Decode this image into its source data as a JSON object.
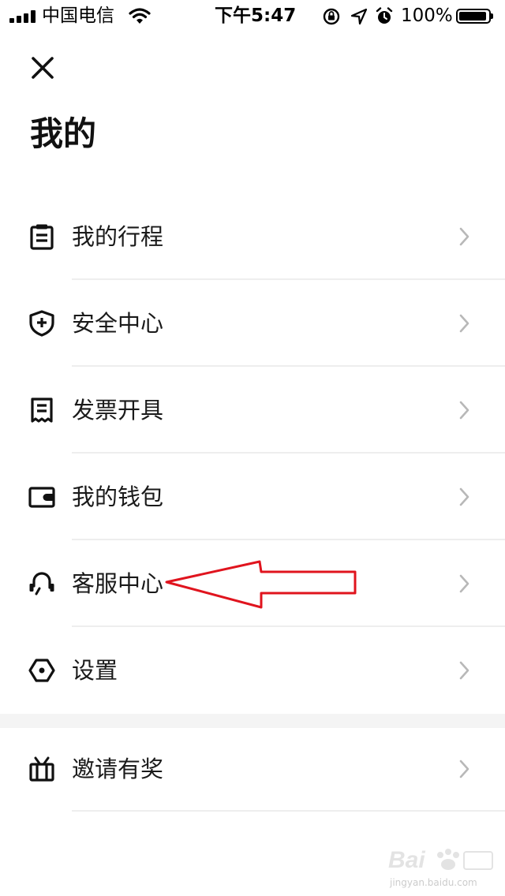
{
  "status_bar": {
    "carrier": "中国电信",
    "time": "下午5:47",
    "battery": "100%",
    "battery_level": 1.0
  },
  "page": {
    "title": "我的"
  },
  "menu": {
    "items": [
      {
        "label": "我的行程",
        "icon": "clipboard-icon"
      },
      {
        "label": "安全中心",
        "icon": "shield-plus-icon"
      },
      {
        "label": "发票开具",
        "icon": "receipt-icon"
      },
      {
        "label": "我的钱包",
        "icon": "wallet-icon"
      },
      {
        "label": "客服中心",
        "icon": "headset-icon"
      },
      {
        "label": "设置",
        "icon": "hexagon-settings-icon"
      }
    ],
    "extra_items": [
      {
        "label": "邀请有奖",
        "icon": "gift-icon"
      }
    ]
  },
  "watermark": {
    "sub": "jingyan.baidu.com"
  },
  "colors": {
    "annotation": "#e0141e",
    "divider": "#eeeeee",
    "section_gap": "#f4f4f4"
  }
}
